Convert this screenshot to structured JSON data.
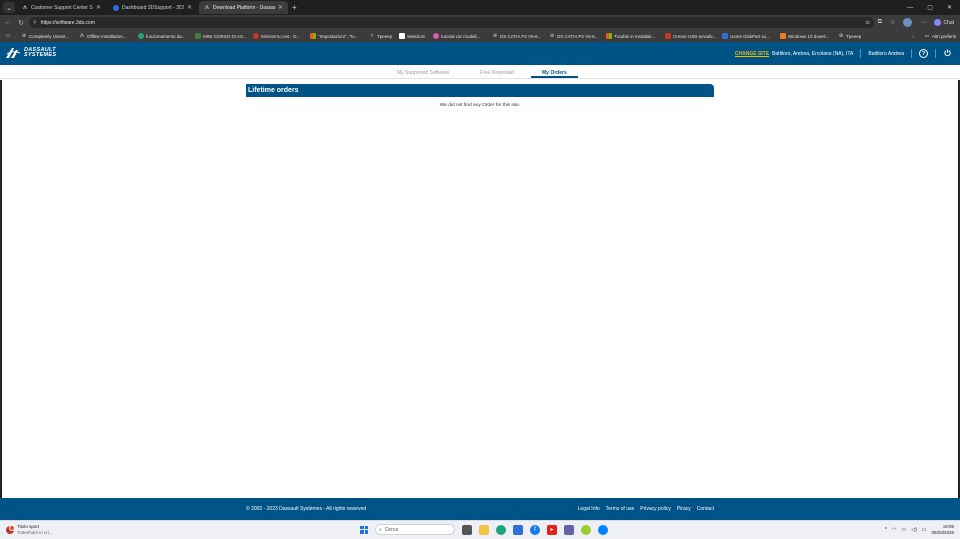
{
  "browser": {
    "tabs": [
      {
        "title": "Customer Support Center SOLIDW",
        "active": false,
        "icon": "solidworks-icon"
      },
      {
        "title": "Dashboard 3DSupport - 3DSuppo",
        "active": false,
        "icon": "3dsupport-icon"
      },
      {
        "title": "Download Platform - Dassault Sys",
        "active": true,
        "icon": "dassault-icon"
      }
    ],
    "url": "https://software.3ds.com",
    "chat_label": "Chat",
    "bookmarks": [
      {
        "label": "Completely Uninst...",
        "icon": "globe-icon"
      },
      {
        "label": "Offline Installation...",
        "icon": "solidworks-icon"
      },
      {
        "label": "funzionamento da...",
        "icon": "edge-icon"
      },
      {
        "label": "MINI CORSO DI AS...",
        "icon": "folder-icon"
      },
      {
        "label": "Ministorno.net - D...",
        "icon": "red-icon"
      },
      {
        "label": "\"Impostazioni\", \"N...",
        "icon": "windows-icon"
      },
      {
        "label": "Tpeeep",
        "icon": "t-icon"
      },
      {
        "label": "Selezioni",
        "icon": "doc-icon"
      },
      {
        "label": "tutorial car modeli...",
        "icon": "pink-icon"
      },
      {
        "label": "DS CATIA P2 V5-6...",
        "icon": "globe-icon"
      },
      {
        "label": "DS CATIA P2 V5-6...",
        "icon": "globe-icon"
      },
      {
        "label": "Trouble in installati...",
        "icon": "windows-icon"
      },
      {
        "label": "Creare USB avviabi...",
        "icon": "red-icon"
      },
      {
        "label": "Usare DiskPart su...",
        "icon": "blue-icon"
      },
      {
        "label": "Windows 10 downl...",
        "icon": "orange-icon"
      },
      {
        "label": "Tpeeep",
        "icon": "globe-icon"
      }
    ],
    "other_bookmarks": "Altri preferiti"
  },
  "header": {
    "logo_line1": "DASSAULT",
    "logo_line2": "SYSTEMES",
    "change_site": "CHANGE SITE",
    "site_name": "Battiloro, Andrea, Ercolano (NA), ITA",
    "user_name": "Battiloro Andrea",
    "help_icon": "help-icon",
    "logout_icon": "power-icon"
  },
  "subnav": {
    "items": [
      {
        "label": "My Supported Software",
        "active": false
      },
      {
        "label": "Free Download",
        "active": false
      },
      {
        "label": "My Orders",
        "active": true
      }
    ]
  },
  "main": {
    "section_title": "Lifetime orders",
    "empty_message": "We did not find any Order for this site."
  },
  "footer": {
    "copyright": "© 2002 - 2023 Dassault Systèmes - All rights reserved",
    "links": [
      "Legal Info",
      "Terms of use",
      "Privacy policy",
      "Piracy",
      "Contact"
    ]
  },
  "taskbar": {
    "weather_title": "Titolo sport",
    "weather_sub": "Tottenham in cri...",
    "search_placeholder": "Cerca",
    "time": "19:06",
    "date": "06/03/2026"
  },
  "colors": {
    "brand": "#005386",
    "accent": "#f2b700",
    "chrome_dark": "#1f1f1f",
    "chrome_mid": "#3b3b3b"
  }
}
